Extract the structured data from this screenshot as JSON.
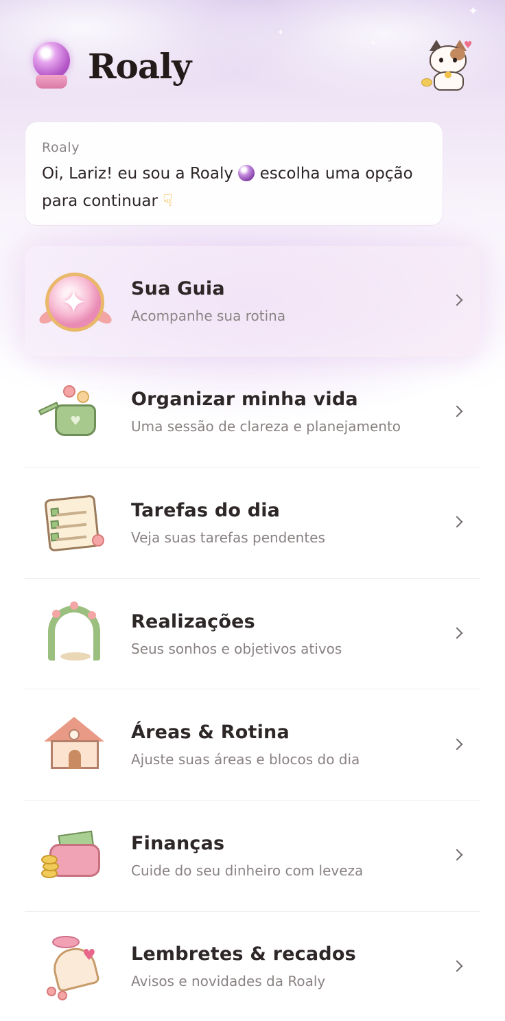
{
  "app": {
    "name": "Roaly"
  },
  "message": {
    "sender": "Roaly",
    "text_before_emoji": "Oi, Lariz! eu sou a Roaly",
    "text_after_emoji": "escolha uma opção para continuar",
    "emoji_1": "crystal-ball",
    "emoji_2": "pointing-down-hand"
  },
  "menu": {
    "items": [
      {
        "title": "Sua Guia",
        "subtitle": "Acompanhe sua rotina",
        "icon": "crystal-orb-icon",
        "featured": true
      },
      {
        "title": "Organizar minha vida",
        "subtitle": "Uma sessão de clareza e planejamento",
        "icon": "watering-can-icon"
      },
      {
        "title": "Tarefas do dia",
        "subtitle": "Veja suas tarefas pendentes",
        "icon": "checklist-notepad-icon"
      },
      {
        "title": "Realizações",
        "subtitle": "Seus sonhos e objetivos ativos",
        "icon": "flower-arch-icon"
      },
      {
        "title": "Áreas & Rotina",
        "subtitle": "Ajuste suas áreas e blocos do dia",
        "icon": "cottage-icon"
      },
      {
        "title": "Finanças",
        "subtitle": "Cuide do seu dinheiro com leveza",
        "icon": "wallet-icon"
      },
      {
        "title": "Lembretes & recados",
        "subtitle": "Avisos e novidades da Roaly",
        "icon": "bell-icon"
      }
    ]
  },
  "colors": {
    "background_top": "#d9c9ec",
    "text_primary": "#2e2727",
    "text_secondary": "#8a8282"
  }
}
